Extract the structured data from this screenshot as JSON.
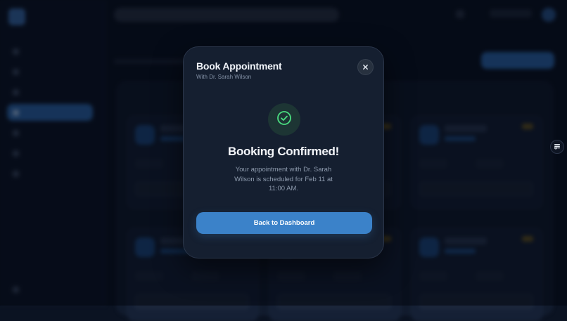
{
  "modal": {
    "title": "Book Appointment",
    "subtitle": "With Dr. Sarah Wilson",
    "close_icon": "close-icon",
    "success_icon": "check-circle-icon",
    "confirm_title": "Booking Confirmed!",
    "confirm_message": "Your appointment with Dr. Sarah Wilson is scheduled for Feb 11 at 11:00 AM.",
    "primary_button": "Back to Dashboard"
  },
  "colors": {
    "accent": "#3b82c9",
    "success": "#4ade80",
    "modal_bg": "#151f30",
    "page_bg": "#0b1322"
  },
  "floating_button_icon": "accessibility-icon"
}
